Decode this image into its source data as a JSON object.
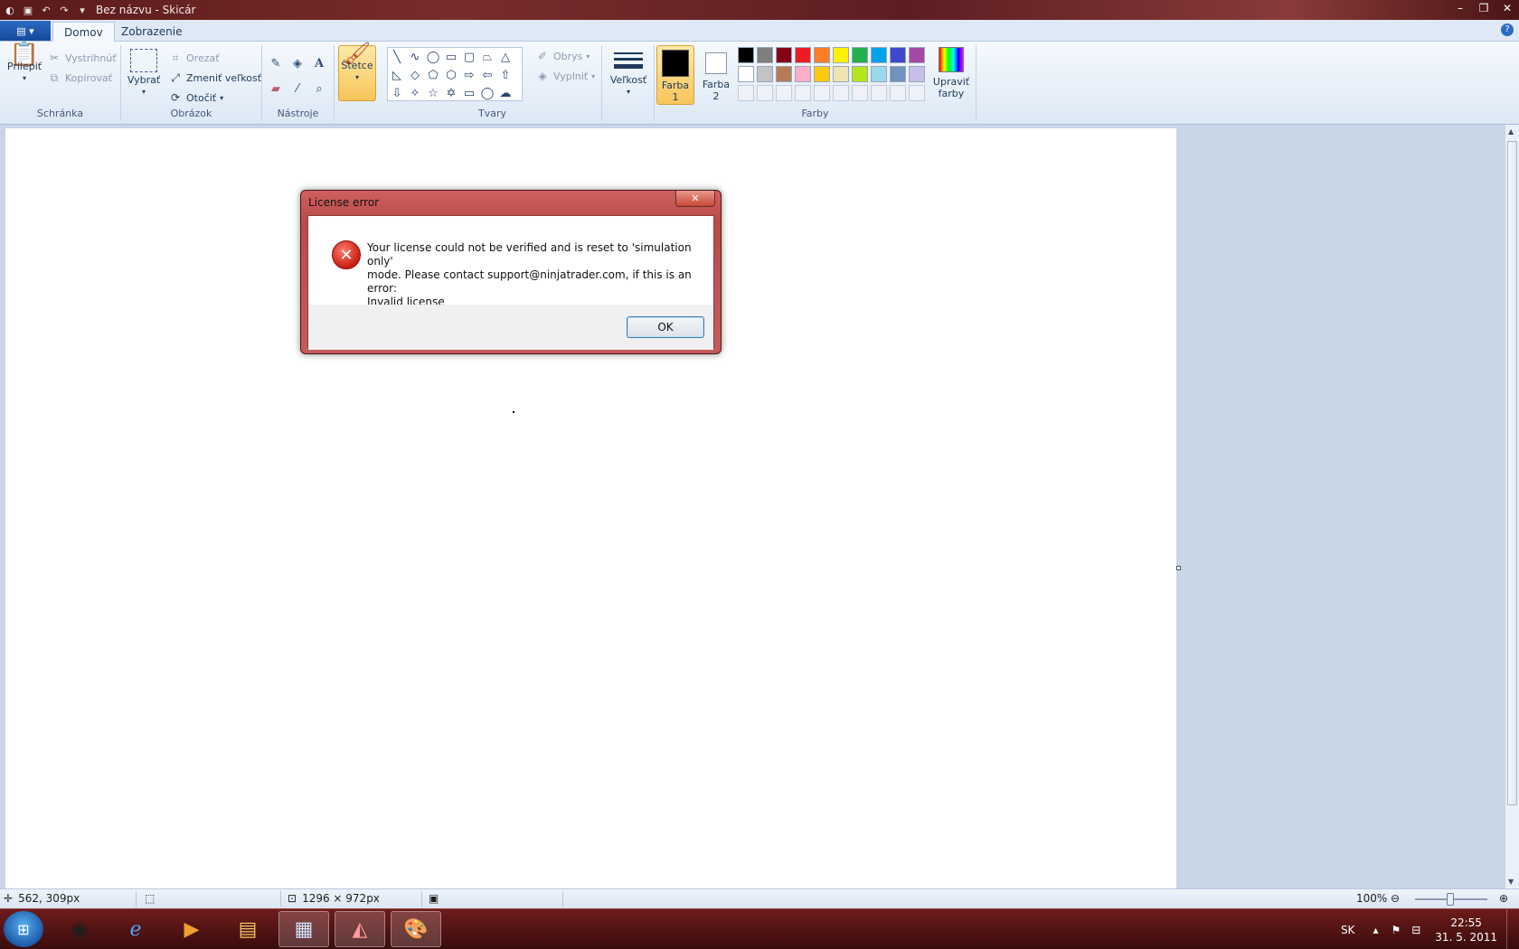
{
  "window": {
    "title": "Bez názvu - Skicár",
    "controls": {
      "minimize": "–",
      "restore": "❐",
      "close": "✕"
    }
  },
  "ribbon": {
    "app_menu_label": "▤ ▾",
    "tabs": [
      {
        "label": "Domov"
      },
      {
        "label": "Zobrazenie"
      }
    ],
    "help": "?",
    "clipboard": {
      "paste": "Prilepiť",
      "cut": "Vystrihnúť",
      "copy": "Kopírovať",
      "group": "Schránka"
    },
    "image": {
      "select": "Vybrať",
      "crop": "Orezať",
      "resize": "Zmeniť veľkosť",
      "rotate": "Otočiť",
      "group": "Obrázok"
    },
    "tools": {
      "group": "Nástroje"
    },
    "brushes": {
      "label": "Štetce"
    },
    "shapes": {
      "outline": "Obrys",
      "fill": "Vyplniť",
      "group": "Tvary"
    },
    "size": {
      "label": "Veľkosť"
    },
    "colors": {
      "color1": "Farba 1",
      "color2": "Farba 2",
      "edit": "Upraviť farby",
      "group": "Farby",
      "primary": "#000000",
      "secondary": "#ffffff",
      "palette_row1": [
        "#000000",
        "#7f7f7f",
        "#880015",
        "#ed1c24",
        "#ff7f27",
        "#fff200",
        "#22b14c",
        "#00a2e8",
        "#3f48cc",
        "#a349a4"
      ],
      "palette_row2": [
        "#ffffff",
        "#c3c3c3",
        "#b97a57",
        "#ffaec9",
        "#ffc90e",
        "#efe4b0",
        "#b5e61d",
        "#99d9ea",
        "#7092be",
        "#c8bfe7"
      ]
    }
  },
  "dialog": {
    "title": "License error",
    "close": "✕",
    "message_line1": "Your license could not be verified and is reset to 'simulation only'",
    "message_line2": "mode. Please contact support@ninjatrader.com, if this is an error:",
    "message_line3": "Invalid license",
    "ok": "OK"
  },
  "statusbar": {
    "cursor_pos": "562, 309px",
    "canvas_size": "1296 × 972px",
    "zoom": "100%"
  },
  "taskbar": {
    "language": "SK",
    "time": "22:55",
    "date": "31. 5. 2011"
  }
}
